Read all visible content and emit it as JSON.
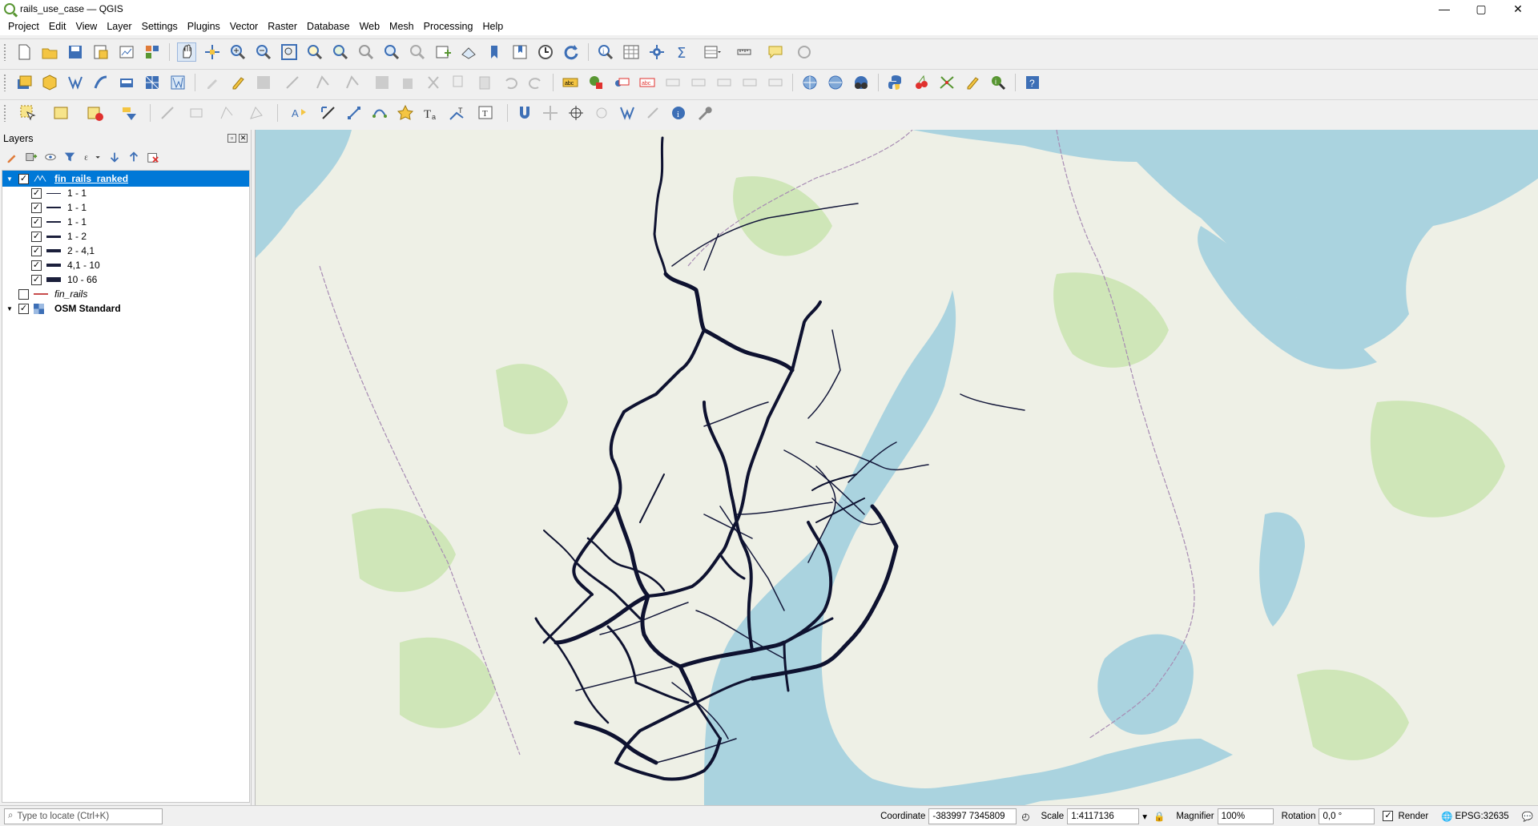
{
  "window": {
    "title": "rails_use_case — QGIS",
    "minimize": "—",
    "maximize": "▢",
    "close": "✕"
  },
  "menu": [
    "Project",
    "Edit",
    "View",
    "Layer",
    "Settings",
    "Plugins",
    "Vector",
    "Raster",
    "Database",
    "Web",
    "Mesh",
    "Processing",
    "Help"
  ],
  "layers_panel": {
    "title": "Layers",
    "items": [
      {
        "label": "fin_rails_ranked",
        "checked": true,
        "selected": true
      },
      {
        "label": "1 - 1",
        "checked": true
      },
      {
        "label": "1 - 1",
        "checked": true
      },
      {
        "label": "1 - 1",
        "checked": true
      },
      {
        "label": "1 - 2",
        "checked": true
      },
      {
        "label": "2 - 4,1",
        "checked": true
      },
      {
        "label": "4,1 - 10",
        "checked": true
      },
      {
        "label": "10 - 66",
        "checked": true
      },
      {
        "label": "fin_rails",
        "checked": false
      },
      {
        "label": "OSM Standard",
        "checked": true
      }
    ]
  },
  "statusbar": {
    "locator_placeholder": "Type to locate (Ctrl+K)",
    "coordinate_label": "Coordinate",
    "coordinate_value": "-383997  7345809",
    "scale_label": "Scale",
    "scale_value": "1:4117136",
    "magnifier_label": "Magnifier",
    "magnifier_value": "100%",
    "rotation_label": "Rotation",
    "rotation_value": "0,0 °",
    "render_label": "Render",
    "crs_label": "EPSG:32635"
  },
  "colors": {
    "selection": "#0078d7",
    "rail": "#0e1230",
    "sea": "#aad3df",
    "land": "#eef0e6",
    "forest": "#cfe6b8"
  }
}
